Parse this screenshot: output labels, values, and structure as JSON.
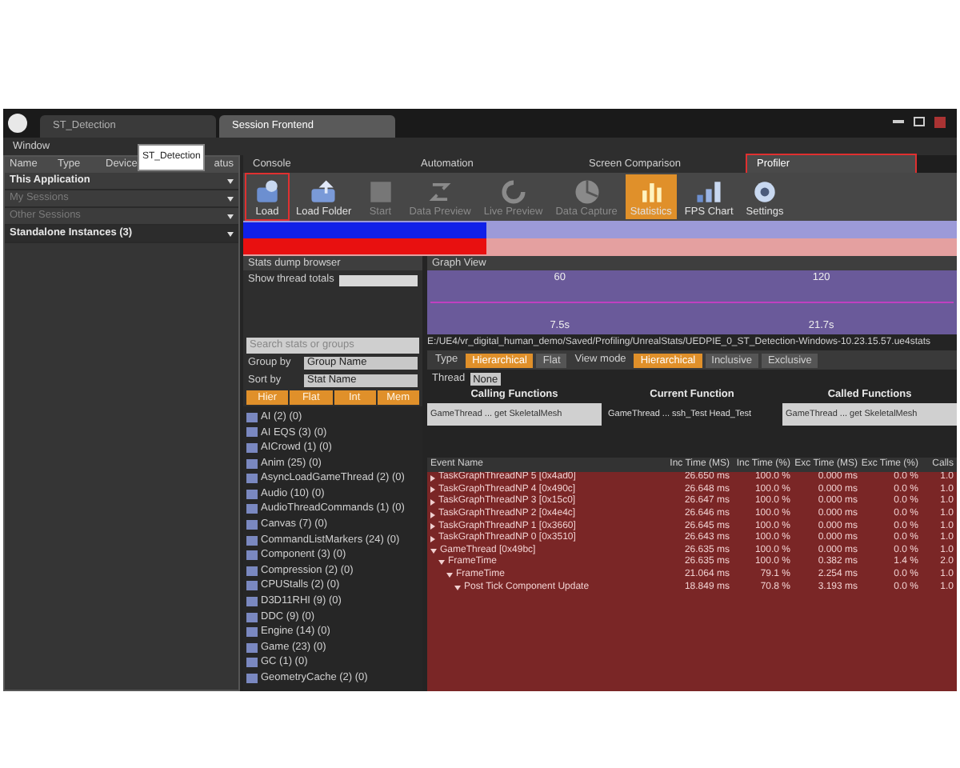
{
  "window": {
    "tabs": [
      {
        "label": "ST_Detection",
        "selected": false
      },
      {
        "label": "Session Frontend",
        "selected": true
      }
    ]
  },
  "menu": [
    "Window"
  ],
  "tooltip": "ST_Detection",
  "sessions": {
    "columns": [
      "Name",
      "Type",
      "Device",
      "atus"
    ],
    "groups": [
      {
        "label": "This Application",
        "disabled": false
      },
      {
        "label": "My Sessions",
        "disabled": true
      },
      {
        "label": "Other Sessions",
        "disabled": true
      },
      {
        "label": "Standalone Instances (3)",
        "disabled": false
      }
    ]
  },
  "tool_tabs": [
    {
      "label": "Console",
      "selected": false,
      "highlighted": false
    },
    {
      "label": "Automation",
      "selected": false,
      "highlighted": false
    },
    {
      "label": "Screen Comparison",
      "selected": false,
      "highlighted": false
    },
    {
      "label": "Profiler",
      "selected": true,
      "highlighted": true
    }
  ],
  "toolbar": [
    {
      "label": "Load",
      "active": false,
      "disabled": false,
      "highlighted": true
    },
    {
      "label": "Load Folder",
      "active": false,
      "disabled": false,
      "highlighted": false
    },
    {
      "label": "Start",
      "active": false,
      "disabled": true,
      "highlighted": false
    },
    {
      "label": "Data Preview",
      "active": false,
      "disabled": true,
      "highlighted": false
    },
    {
      "label": "Live Preview",
      "active": false,
      "disabled": true,
      "highlighted": false
    },
    {
      "label": "Data Capture",
      "active": false,
      "disabled": true,
      "highlighted": false
    },
    {
      "label": "Statistics",
      "active": true,
      "disabled": false,
      "highlighted": false
    },
    {
      "label": "FPS Chart",
      "active": false,
      "disabled": false,
      "highlighted": false
    },
    {
      "label": "Settings",
      "active": false,
      "disabled": false,
      "highlighted": false
    }
  ],
  "stats_browser": {
    "title": "Stats dump browser",
    "show_thread_totals": "Show thread totals",
    "search_placeholder": "Search stats or groups",
    "group_by": {
      "label": "Group by",
      "value": "Group Name"
    },
    "sort_by": {
      "label": "Sort by",
      "value": "Stat Name"
    },
    "filters": [
      "Hier",
      "Flat",
      "Int",
      "Mem"
    ],
    "groups": [
      "AI (2) (0)",
      "AI EQS (3) (0)",
      "AICrowd (1) (0)",
      "Anim (25) (0)",
      "AsyncLoadGameThread (2) (0)",
      "Audio (10) (0)",
      "AudioThreadCommands (1) (0)",
      "Canvas (7) (0)",
      "CommandListMarkers (24) (0)",
      "Component (3) (0)",
      "Compression (2) (0)",
      "CPUStalls (2) (0)",
      "D3D11RHI (9) (0)",
      "DDC (9) (0)",
      "Engine (14) (0)",
      "Game (23) (0)",
      "GC (1) (0)",
      "GeometryCache (2) (0)"
    ]
  },
  "graph_view": {
    "title": "Graph View",
    "top_ticks": [
      "60",
      "120"
    ],
    "bottom_ticks": [
      "7.5s",
      "21.7s"
    ]
  },
  "event_graph": {
    "path": "E:/UE4/vr_digital_human_demo/Saved/Profiling/UnrealStats/UEDPIE_0_ST_Detection-Windows-10.23.15.57.ue4stats",
    "type": {
      "label": "Type",
      "options": [
        {
          "label": "Hierarchical",
          "selected": true
        },
        {
          "label": "Flat",
          "selected": false
        }
      ]
    },
    "view_mode": {
      "label": "View mode",
      "options": [
        {
          "label": "Hierarchical",
          "selected": true
        },
        {
          "label": "Inclusive",
          "selected": false
        },
        {
          "label": "Exclusive",
          "selected": false
        }
      ]
    },
    "thread": {
      "label": "Thread",
      "value": "None"
    },
    "functions": [
      {
        "title": "Calling Functions",
        "entry": "GameThread ... get SkeletalMesh"
      },
      {
        "title": "Current Function",
        "entry": "GameThread ... ssh_Test Head_Test"
      },
      {
        "title": "Called Functions",
        "entry": "GameThread ... get SkeletalMesh"
      }
    ],
    "table": {
      "columns": [
        "Event Name",
        "Inc Time (MS)",
        "Inc Time (%)",
        "Exc Time (MS)",
        "Exc Time (%)",
        "Calls"
      ],
      "rows": [
        {
          "cells": [
            "TaskGraphThreadNP 5 [0x4ad0]",
            "26.650 ms",
            "100.0 %",
            "0.000 ms",
            "0.0 %",
            "1.0"
          ],
          "expanded": false
        },
        {
          "cells": [
            "TaskGraphThreadNP 4 [0x490c]",
            "26.648 ms",
            "100.0 %",
            "0.000 ms",
            "0.0 %",
            "1.0"
          ],
          "expanded": false
        },
        {
          "cells": [
            "TaskGraphThreadNP 3 [0x15c0]",
            "26.647 ms",
            "100.0 %",
            "0.000 ms",
            "0.0 %",
            "1.0"
          ],
          "expanded": false
        },
        {
          "cells": [
            "TaskGraphThreadNP 2 [0x4e4c]",
            "26.646 ms",
            "100.0 %",
            "0.000 ms",
            "0.0 %",
            "1.0"
          ],
          "expanded": false
        },
        {
          "cells": [
            "TaskGraphThreadNP 1 [0x3660]",
            "26.645 ms",
            "100.0 %",
            "0.000 ms",
            "0.0 %",
            "1.0"
          ],
          "expanded": false
        },
        {
          "cells": [
            "TaskGraphThreadNP 0 [0x3510]",
            "26.643 ms",
            "100.0 %",
            "0.000 ms",
            "0.0 %",
            "1.0"
          ],
          "expanded": false
        },
        {
          "cells": [
            "GameThread [0x49bc]",
            "26.635 ms",
            "100.0 %",
            "0.000 ms",
            "0.0 %",
            "1.0"
          ],
          "expanded": true,
          "children": [
            {
              "cells": [
                "FrameTime",
                "26.635 ms",
                "100.0 %",
                "0.382 ms",
                "1.4 %",
                "2.0"
              ],
              "expanded": true,
              "children": [
                {
                  "cells": [
                    "FrameTime",
                    "21.064 ms",
                    "79.1 %",
                    "2.254 ms",
                    "0.0 %",
                    "1.0"
                  ],
                  "expanded": true,
                  "children": [
                    {
                      "cells": [
                        "Post Tick Component Update",
                        "18.849 ms",
                        "70.8 %",
                        "3.193 ms",
                        "0.0 %",
                        "1.0"
                      ],
                      "expanded": true
                    }
                  ]
                }
              ]
            }
          ]
        }
      ]
    }
  }
}
